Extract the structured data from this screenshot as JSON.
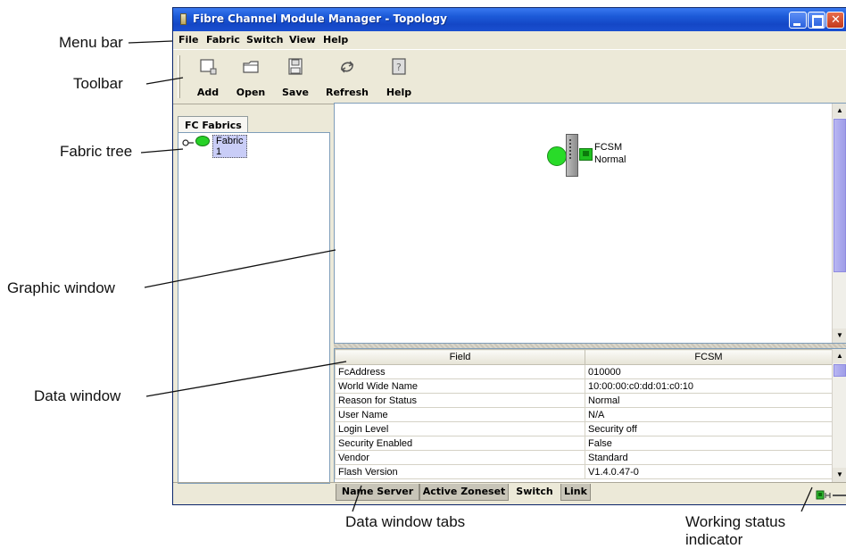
{
  "window": {
    "title": "Fibre Channel Module Manager - Topology"
  },
  "menubar": {
    "items": [
      "File",
      "Fabric",
      "Switch",
      "View",
      "Help"
    ]
  },
  "toolbar": {
    "buttons": [
      {
        "label": "Add",
        "icon": "add-icon"
      },
      {
        "label": "Open",
        "icon": "open-folder-icon"
      },
      {
        "label": "Save",
        "icon": "save-disk-icon"
      },
      {
        "label": "Refresh",
        "icon": "refresh-icon"
      },
      {
        "label": "Help",
        "icon": "help-icon"
      }
    ]
  },
  "tree": {
    "tab_label": "FC Fabrics",
    "nodes": [
      {
        "label": "Fabric 1",
        "status_color": "#27d127"
      }
    ]
  },
  "graphic": {
    "switch": {
      "name": "FCSM",
      "status": "Normal",
      "status_color": "#29db29"
    }
  },
  "data_table": {
    "columns": [
      "Field",
      "FCSM"
    ],
    "rows": [
      [
        "FcAddress",
        "010000"
      ],
      [
        "World Wide Name",
        "10:00:00:c0:dd:01:c0:10"
      ],
      [
        "Reason for Status",
        "Normal"
      ],
      [
        "User Name",
        "N/A"
      ],
      [
        "Login Level",
        "Security off"
      ],
      [
        "Security Enabled",
        "False"
      ],
      [
        "Vendor",
        "Standard"
      ],
      [
        "Flash Version",
        "V1.4.0.47-0"
      ]
    ]
  },
  "data_tabs": {
    "tabs": [
      "Name Server",
      "Active Zoneset",
      "Switch",
      "Link"
    ],
    "selected": "Switch"
  },
  "callouts": {
    "menu_bar": "Menu bar",
    "toolbar": "Toolbar",
    "fabric_tree": "Fabric tree",
    "graphic_window": "Graphic window",
    "data_window": "Data window",
    "data_window_tabs": "Data window tabs",
    "working_status_line1": "Working status",
    "working_status_line2": "indicator"
  }
}
